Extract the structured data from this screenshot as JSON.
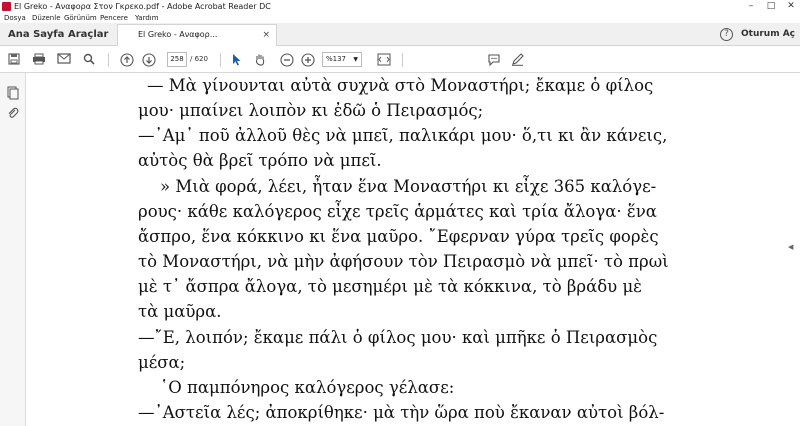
{
  "window": {
    "title": "El Greko - Αναφορα Στον Γκρεκο.pdf - Adobe Acrobat Reader DC",
    "minimize": "–",
    "maximize": "□",
    "close": "✕"
  },
  "menu": [
    "Dosya",
    "Düzenle",
    "Görünüm",
    "Pencere",
    "Yardım"
  ],
  "tabs": {
    "home": "Ana Sayfa",
    "tools": "Araçlar",
    "document": "El Greko - Αναφορ...",
    "close": "×",
    "signin": "Oturum Aç",
    "help": "?"
  },
  "toolbar": {
    "page_current": "258",
    "page_total": "/ 620",
    "zoom": "%137"
  },
  "icons": {
    "save": "save-icon",
    "print": "print-icon",
    "email": "mail-icon",
    "search": "search-icon",
    "prev": "arrow-up-icon",
    "next": "arrow-down-icon",
    "select": "cursor-icon",
    "hand": "hand-icon",
    "zoom_out": "minus-icon",
    "zoom_in": "plus-icon",
    "fit": "fit-page-icon",
    "comment": "comment-icon",
    "sign": "pen-icon",
    "thumbnails": "pages-icon",
    "attachments": "paperclip-icon"
  },
  "document": {
    "lines": [
      "— Μὰ γίνουνται αὐτὰ συχνὰ στὸ Μοναστήρι; ἔκαμε ὁ φίλος",
      "μου· μπαίνει λοιπὸν κι ἐδῶ ὁ Πειρασμός;",
      "—᾿Αμ᾿ ποῦ ἀλλοῦ θὲς νὰ μπεῖ, παλικάρι μου· ὅ,τι κι ἂν κάνεις,",
      "αὐτὸς θὰ βρεῖ τρόπο νὰ μπεῖ.",
      "» Μιὰ φορά, λέει, ἦταν ἕνα Μοναστήρι κι εἶχε 365 καλόγε-",
      "ρους· κάθε καλόγερος εἶχε τρεῖς ἁρμάτες καὶ τρία ἄλογα· ἕνα",
      "ἄσπρο, ἕνα κόκκινο κι ἕνα μαῦρο. ῎Εφερναν γύρα τρεῖς φορὲς",
      "τὸ Μοναστήρι, νὰ μὴν ἀφήσουν τὸν Πειρασμὸ νὰ μπεῖ· τὸ πρωὶ",
      "μὲ τ᾿ ἄσπρα ἄλογα, τὸ μεσημέρι μὲ τὰ κόκκινα, τὸ βράδυ μὲ",
      "τὰ μαῦρα.",
      "—῎Ε, λοιπόν; ἔκαμε πάλι ὁ φίλος μου· καὶ μπῆκε ὁ Πειρασμὸς",
      "μέσα;",
      "῾Ο παμπόνηρος καλόγερος γέλασε:",
      "—᾿Αστεῖα λές; ἀποκρίθηκε· μὰ τὴν ὥρα ποὺ ἔκαναν αὐτοὶ βόλ-"
    ]
  }
}
